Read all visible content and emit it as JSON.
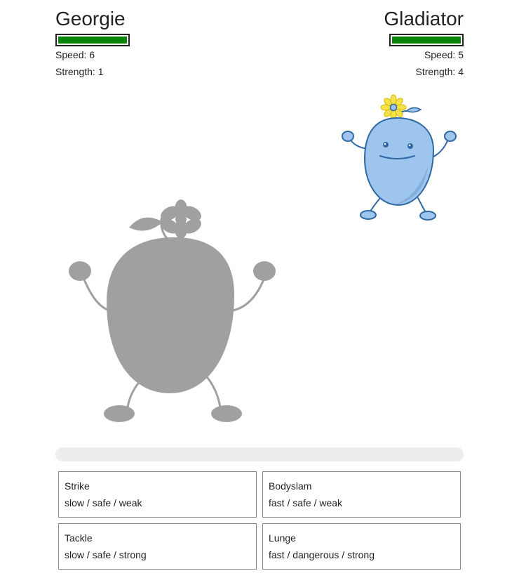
{
  "player": {
    "name": "Georgie",
    "health_fraction": 1.0,
    "speed_label": "Speed: 6",
    "strength_label": "Strength: 1"
  },
  "opponent": {
    "name": "Gladiator",
    "health_fraction": 1.0,
    "speed_label": "Speed: 5",
    "strength_label": "Strength: 4"
  },
  "battle_log": "",
  "moves": [
    {
      "name": "Strike",
      "desc": "slow / safe / weak"
    },
    {
      "name": "Bodyslam",
      "desc": "fast / safe / weak"
    },
    {
      "name": "Tackle",
      "desc": "slow / safe / strong"
    },
    {
      "name": "Lunge",
      "desc": "fast / dangerous / strong"
    }
  ],
  "colors": {
    "health_green": "#0a830a",
    "player_silhouette": "#a0a0a0",
    "opponent_body": "#9ec5ee",
    "opponent_outline": "#2f68a3",
    "flower_yellow": "#f5e24a"
  },
  "icons": {
    "player": "player-creature-icon",
    "opponent": "opponent-creature-icon"
  }
}
